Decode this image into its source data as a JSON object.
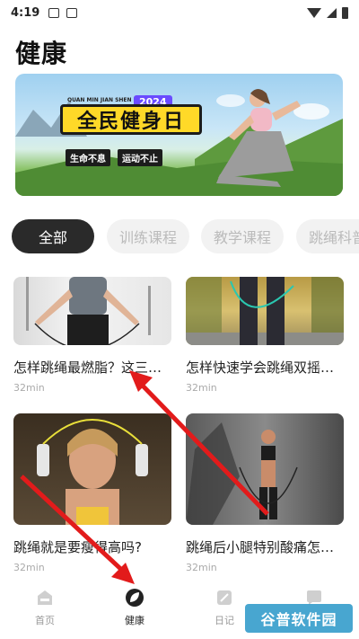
{
  "status_bar": {
    "time": "4:19"
  },
  "page": {
    "title": "健康"
  },
  "banner": {
    "eyebrow": "QUAN MIN JIAN SHEN RI",
    "year": "2024",
    "headline": "全民健身日",
    "tag_left": "生命不息",
    "tag_right": "运动不止"
  },
  "tabs": [
    {
      "label": "全部",
      "active": true
    },
    {
      "label": "训练课程",
      "active": false
    },
    {
      "label": "教学课程",
      "active": false
    },
    {
      "label": "跳绳科普",
      "active": false
    }
  ],
  "cards": [
    {
      "title": "怎样跳绳最燃脂？这三…",
      "duration": "32min"
    },
    {
      "title": "怎样快速学会跳绳双摇…",
      "duration": "32min"
    },
    {
      "title": "跳绳就是要瘦得高吗?",
      "duration": "32min"
    },
    {
      "title": "跳绳后小腿特别酸痛怎…",
      "duration": "32min"
    }
  ],
  "tabbar": [
    {
      "label": "首页",
      "icon": "home-icon",
      "active": false
    },
    {
      "label": "健康",
      "icon": "leaf-icon",
      "active": true
    },
    {
      "label": "日记",
      "icon": "diary-icon",
      "active": false
    },
    {
      "label": "",
      "icon": "chat-icon",
      "active": false
    }
  ],
  "watermark": {
    "text": "谷普软件园"
  },
  "colors": {
    "accent": "#2a2a2a",
    "banner_yellow": "#ffd928",
    "arrow_red": "#e21b1b"
  }
}
